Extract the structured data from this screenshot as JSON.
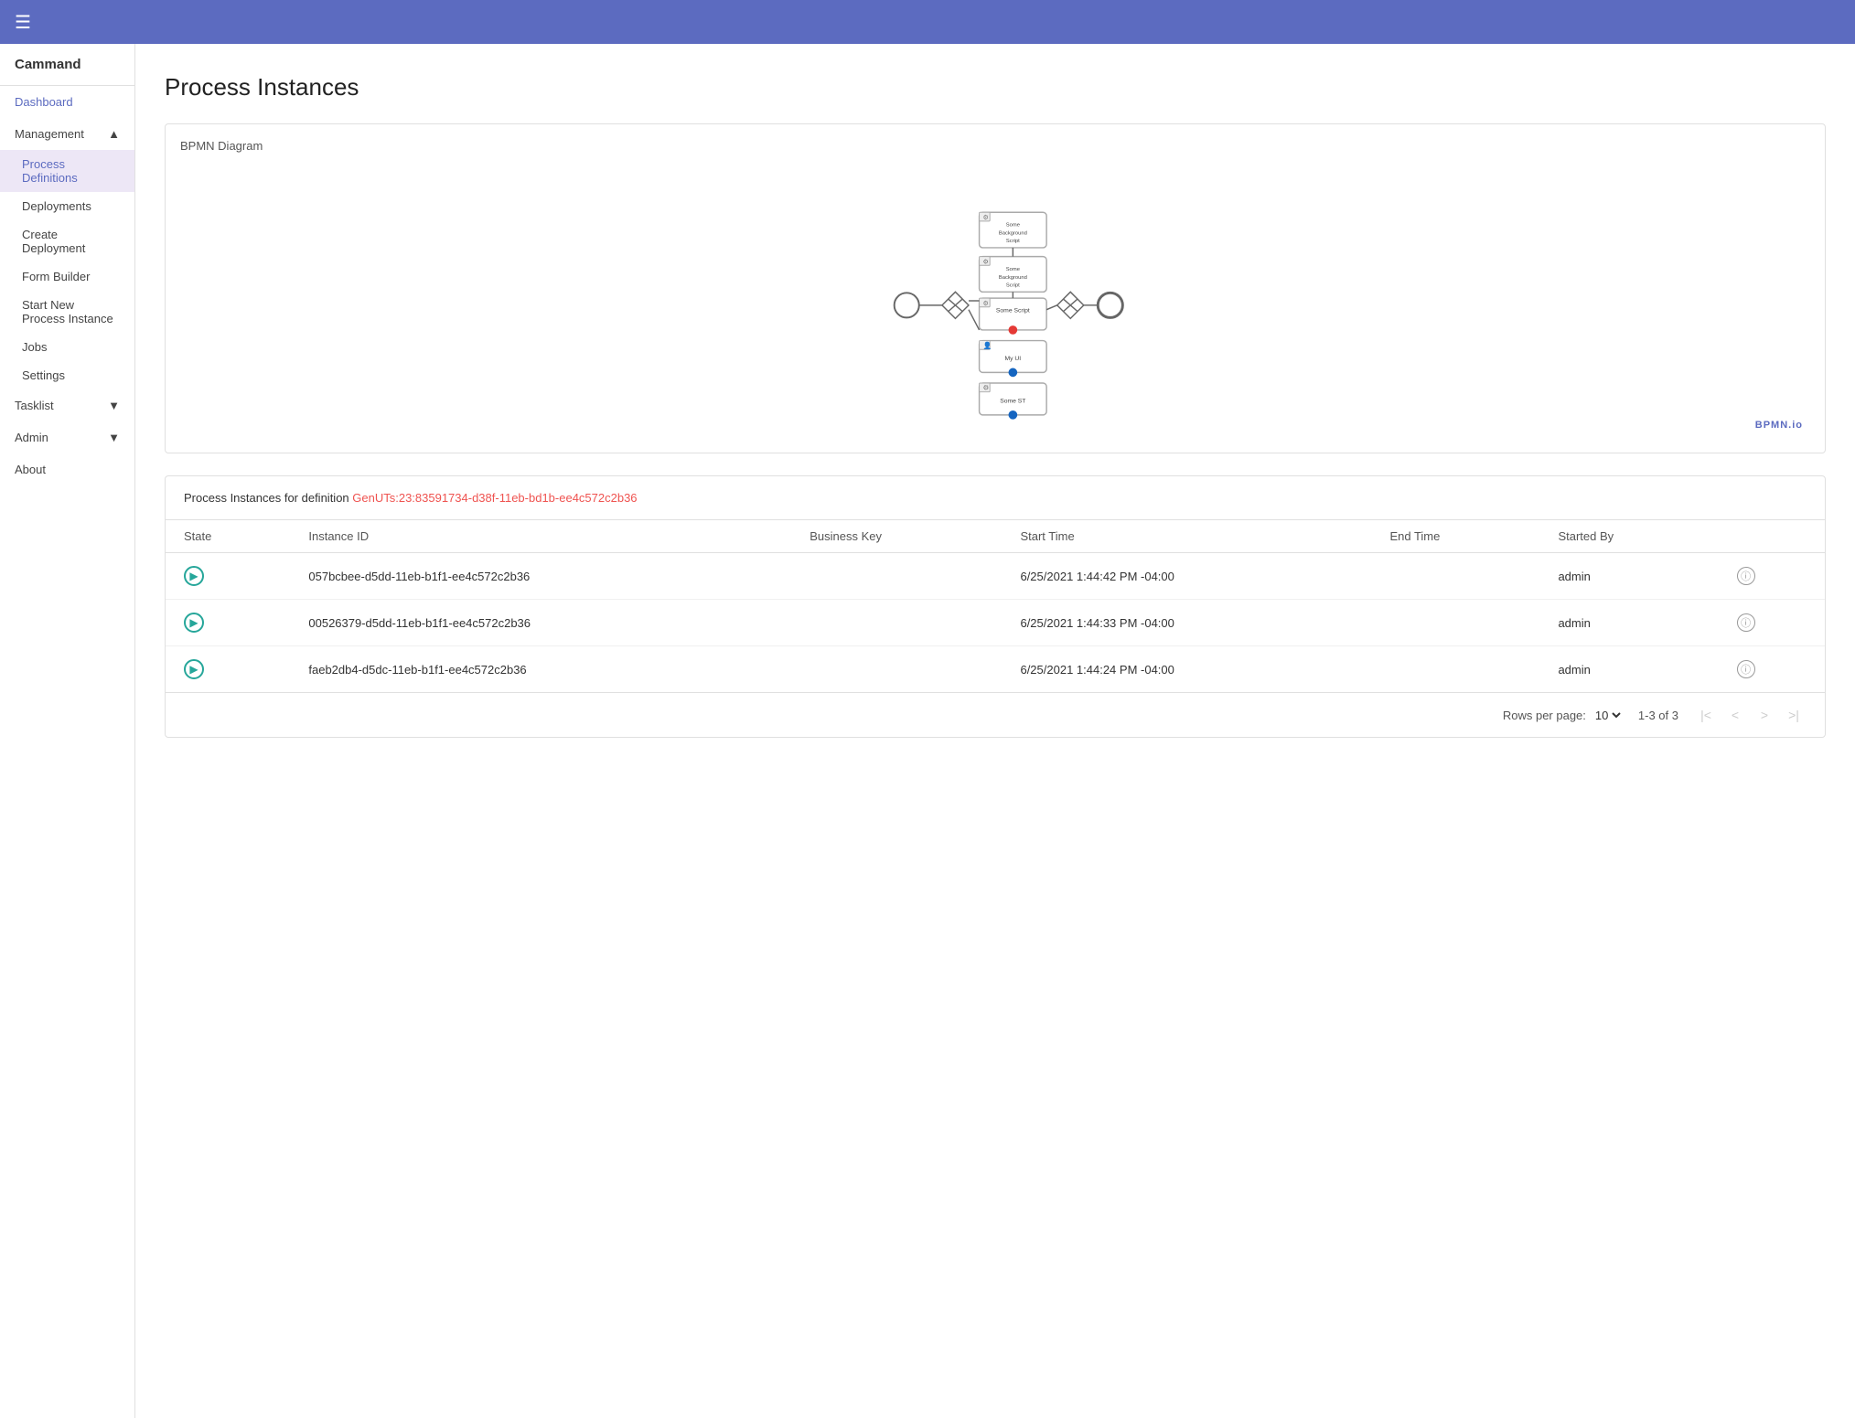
{
  "app": {
    "brand": "Cammand"
  },
  "topbar": {
    "menu_icon": "☰"
  },
  "sidebar": {
    "dashboard_label": "Dashboard",
    "management_label": "Management",
    "process_definitions_label": "Process Definitions",
    "deployments_label": "Deployments",
    "create_deployment_label": "Create Deployment",
    "form_builder_label": "Form Builder",
    "start_new_process_label": "Start New Process Instance",
    "jobs_label": "Jobs",
    "settings_label": "Settings",
    "tasklist_label": "Tasklist",
    "admin_label": "Admin",
    "about_label": "About"
  },
  "page": {
    "title": "Process Instances"
  },
  "bpmn": {
    "label": "BPMN Diagram",
    "watermark": "BPMN.io"
  },
  "instances": {
    "header_text": "Process Instances for definition ",
    "definition_id": "GenUTs:23:83591734-d38f-11eb-bd1b-ee4c572c2b36",
    "columns": {
      "state": "State",
      "instance_id": "Instance ID",
      "business_key": "Business Key",
      "start_time": "Start Time",
      "end_time": "End Time",
      "started_by": "Started By"
    },
    "rows": [
      {
        "state": "active",
        "instance_id": "057bcbee-d5dd-11eb-b1f1-ee4c572c2b36",
        "business_key": "",
        "start_time": "6/25/2021 1:44:42 PM -04:00",
        "end_time": "",
        "started_by": "admin"
      },
      {
        "state": "active",
        "instance_id": "00526379-d5dd-11eb-b1f1-ee4c572c2b36",
        "business_key": "",
        "start_time": "6/25/2021 1:44:33 PM -04:00",
        "end_time": "",
        "started_by": "admin"
      },
      {
        "state": "active",
        "instance_id": "faeb2db4-d5dc-11eb-b1f1-ee4c572c2b36",
        "business_key": "",
        "start_time": "6/25/2021 1:44:24 PM -04:00",
        "end_time": "",
        "started_by": "admin"
      }
    ],
    "rows_per_page_label": "Rows per page:",
    "rows_per_page_value": "10",
    "page_info": "1-3 of 3"
  }
}
